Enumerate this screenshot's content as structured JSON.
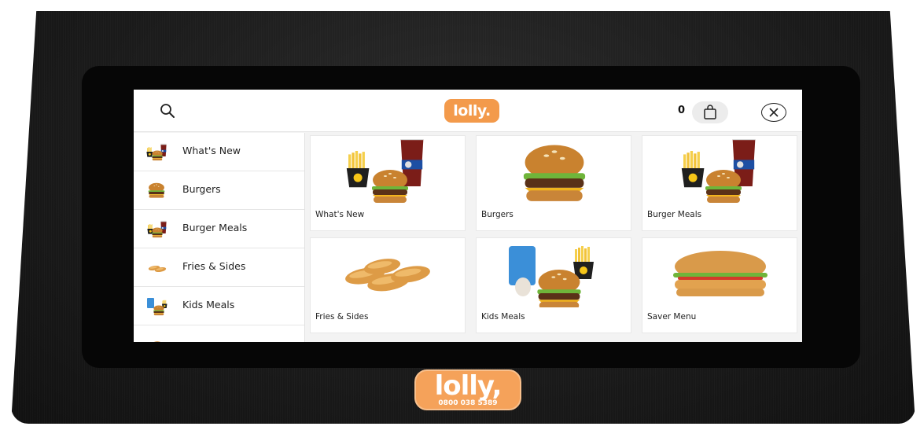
{
  "header": {
    "logo_text": "lolly.",
    "cart_count": "0"
  },
  "sidebar": {
    "items": [
      {
        "label": "What's New"
      },
      {
        "label": "Burgers"
      },
      {
        "label": "Burger Meals"
      },
      {
        "label": "Fries & Sides"
      },
      {
        "label": "Kids Meals"
      }
    ]
  },
  "grid": {
    "tiles": [
      {
        "label": "What's New"
      },
      {
        "label": "Burgers"
      },
      {
        "label": "Burger Meals"
      },
      {
        "label": "Fries & Sides"
      },
      {
        "label": "Kids Meals"
      },
      {
        "label": "Saver Menu"
      }
    ]
  },
  "device": {
    "badge_brand": "lolly,",
    "badge_phone": "0800 038 5389"
  },
  "colors": {
    "brand_orange": "#f39a4b",
    "device_black": "#1a1a1a",
    "screen_bg": "#f3f3f3"
  },
  "icons": {
    "search": "search-icon",
    "cart": "shopping-bag-icon",
    "close": "close-icon"
  }
}
